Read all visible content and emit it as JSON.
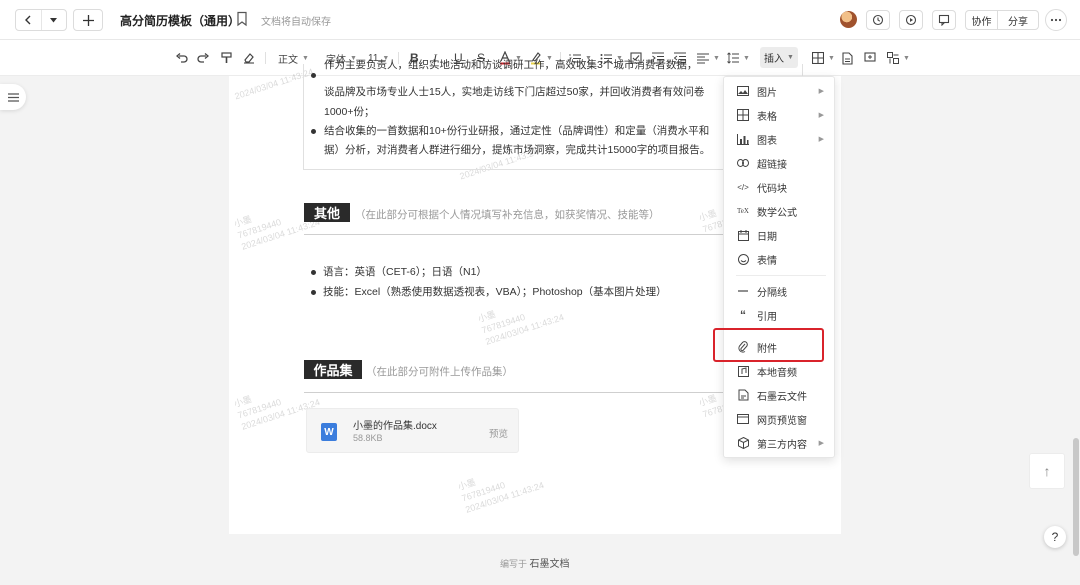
{
  "header": {
    "back_icon": "chevron-left-icon",
    "dropdown_icon": "caret-down-icon",
    "new_icon": "plus-icon",
    "title": "高分简历模板（通用）",
    "autosave": "文档将自动保存",
    "collab_label": "协作",
    "share_label": "分享"
  },
  "toolbar": {
    "paragraph": "正文",
    "font": "字体",
    "size": "11",
    "insert": "插入"
  },
  "doc": {
    "p1_line0": "作为主要负责人，组织实地活动和访谈调研工作，高效收集3个城市消费者数据，",
    "p1_line1": "谈品牌及市场专业人士15人，实地走访线下门店超过50家，并回收消费者有效问卷",
    "p1_line2": "1000+份；",
    "p2_line1": "结合收集的一首数据和10+份行业研报，通过定性（品牌调性）和定量（消费水平和",
    "p2_line2": "据）分析，对消费者人群进行细分，提炼市场洞察，完成共计15000字的项目报告。",
    "section_other": "其他",
    "section_other_hint": "（在此部分可根据个人情况填写补充信息，如获奖情况、技能等）",
    "lang": "语言：英语（CET-6）；日语（N1）",
    "skills": "技能：Excel（熟悉使用数据透视表，VBA）；Photoshop（基本图片处理）",
    "section_portfolio": "作品集",
    "section_portfolio_hint": "（在此部分可附件上传作品集）",
    "file_name": "小墨的作品集.docx",
    "file_size": "58.8KB",
    "preview": "预览",
    "footer_prefix": "编写于",
    "footer_brand": "石墨文档"
  },
  "watermark": {
    "name": "小墨",
    "id": "767819440",
    "time": "2024/03/04 11:43:24"
  },
  "insert_menu": {
    "items": [
      {
        "label": "图片",
        "icon": "image-icon",
        "submenu": true
      },
      {
        "label": "表格",
        "icon": "table-icon",
        "submenu": true
      },
      {
        "label": "图表",
        "icon": "chart-icon",
        "submenu": true
      },
      {
        "label": "超链接",
        "icon": "link-icon",
        "submenu": false
      },
      {
        "label": "代码块",
        "icon": "code-icon",
        "submenu": false
      },
      {
        "label": "数学公式",
        "icon": "formula-icon",
        "submenu": false
      },
      {
        "label": "日期",
        "icon": "calendar-icon",
        "submenu": false
      },
      {
        "label": "表情",
        "icon": "emoji-icon",
        "submenu": false
      },
      {
        "label": "分隔线",
        "icon": "divider-icon",
        "submenu": false
      },
      {
        "label": "引用",
        "icon": "quote-icon",
        "submenu": false
      },
      {
        "label": "附件",
        "icon": "paperclip-icon",
        "submenu": false
      },
      {
        "label": "本地音频",
        "icon": "audio-icon",
        "submenu": false
      },
      {
        "label": "石墨云文件",
        "icon": "cloud-file-icon",
        "submenu": false
      },
      {
        "label": "网页预览窗",
        "icon": "webpage-icon",
        "submenu": false
      },
      {
        "label": "第三方内容",
        "icon": "cube-icon",
        "submenu": true
      }
    ]
  },
  "misc": {
    "back_to_top": "↑",
    "help": "?"
  },
  "colors": {
    "accent_red": "#d9232b",
    "section_label_bg": "#2a2a2a",
    "word_blue": "#3b7ddd"
  }
}
